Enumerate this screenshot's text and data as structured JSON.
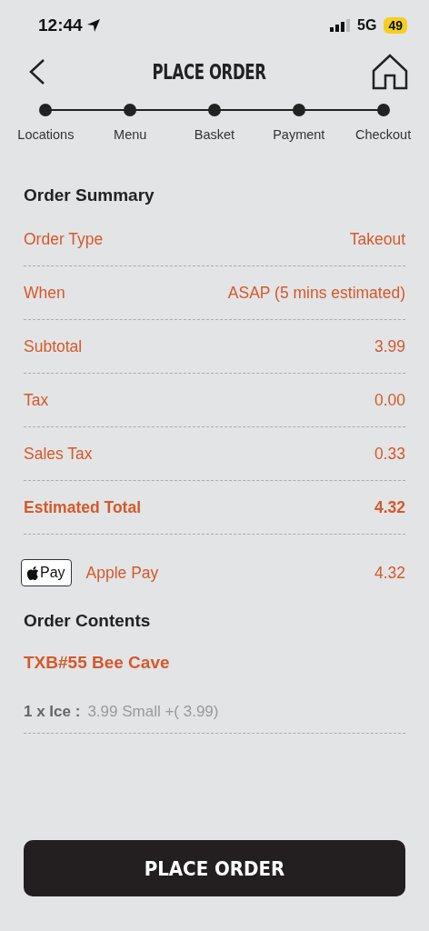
{
  "status_bar": {
    "time": "12:44",
    "network": "5G",
    "battery": "49"
  },
  "header": {
    "title": "PLACE ORDER"
  },
  "steps": [
    {
      "label": "Locations"
    },
    {
      "label": "Menu"
    },
    {
      "label": "Basket"
    },
    {
      "label": "Payment"
    },
    {
      "label": "Checkout"
    }
  ],
  "summary": {
    "title": "Order Summary",
    "rows": [
      {
        "kind": "line",
        "label": "Order Type",
        "value": "Takeout"
      },
      {
        "kind": "line",
        "label": "When",
        "value": "ASAP (5 mins estimated)"
      },
      {
        "kind": "line",
        "label": "Subtotal",
        "value": "3.99"
      },
      {
        "kind": "line",
        "label": "Tax",
        "value": "0.00"
      },
      {
        "kind": "line",
        "label": "Sales Tax",
        "value": "0.33"
      },
      {
        "kind": "total",
        "label": "Estimated Total",
        "value": "4.32"
      }
    ],
    "payment": {
      "badge": "Pay",
      "method": "Apple Pay",
      "amount": "4.32"
    }
  },
  "contents": {
    "title": "Order Contents",
    "store": "TXB#55 Bee Cave",
    "items": [
      {
        "quantity": "1 x Ice :",
        "detail": "3.99 Small +( 3.99)"
      }
    ]
  },
  "place_order_button": "PLACE ORDER"
}
